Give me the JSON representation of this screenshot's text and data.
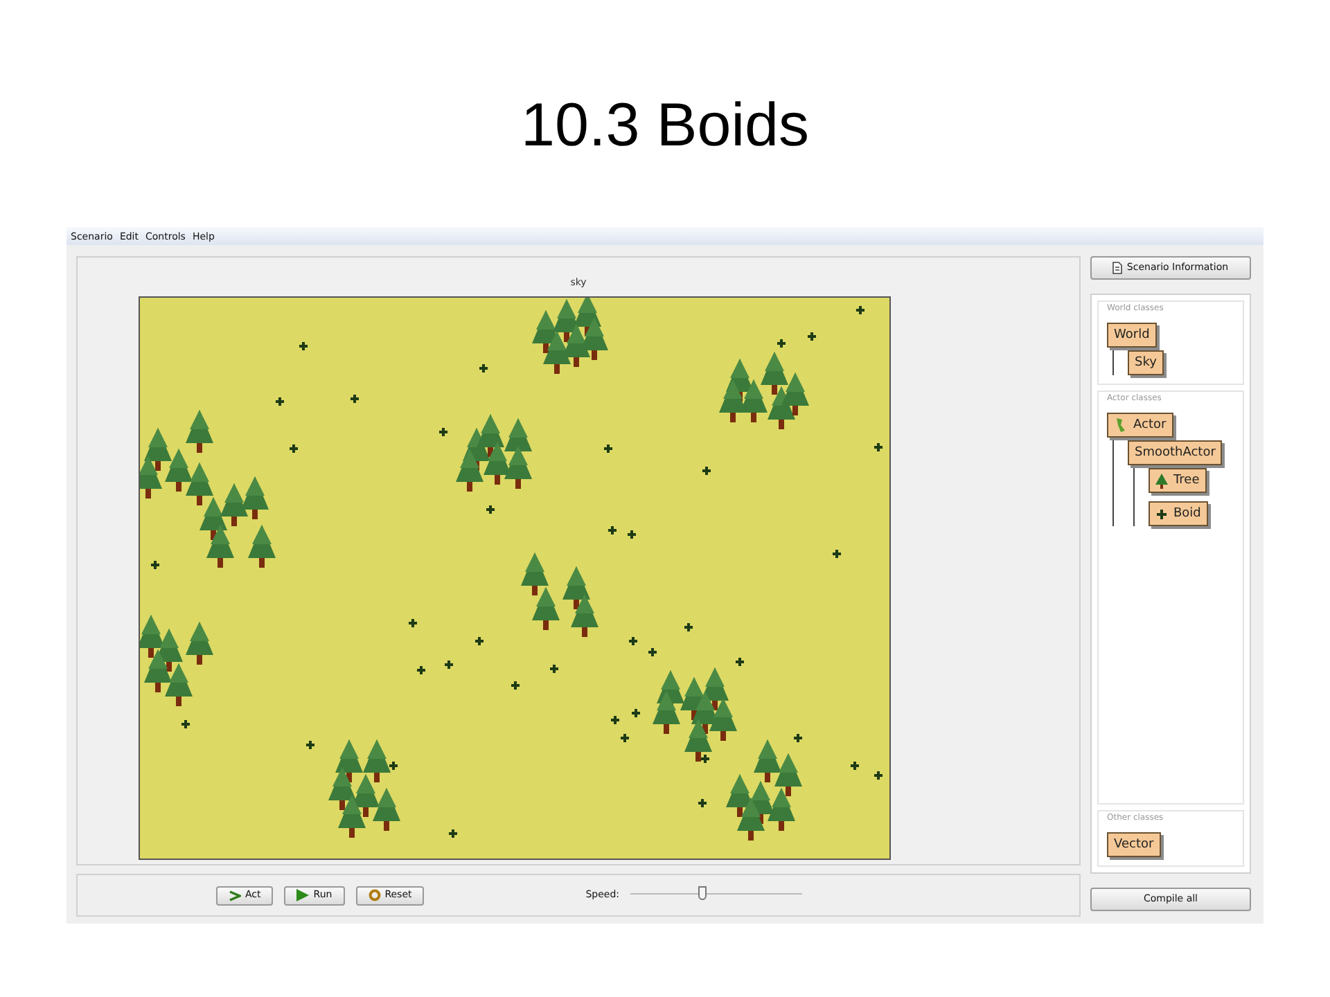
{
  "slide": {
    "title": "10.3 Boids"
  },
  "menu": [
    "Scenario",
    "Edit",
    "Controls",
    "Help"
  ],
  "world": {
    "title": "sky"
  },
  "controls": {
    "buttons": [
      {
        "label": "Act",
        "kind": "step"
      },
      {
        "label": "Run",
        "kind": "play"
      },
      {
        "label": "Reset",
        "kind": "reset"
      }
    ],
    "speed": {
      "label": "Speed:",
      "level": 0.42
    }
  },
  "sidebar": {
    "info_button": "Scenario Information",
    "sections": [
      {
        "label": "World classes",
        "classes": [
          {
            "name": "World",
            "children": [
              {
                "name": "Sky"
              }
            ]
          }
        ]
      },
      {
        "label": "Actor classes",
        "classes": [
          {
            "name": "Actor",
            "kind": "actor",
            "children": [
              {
                "name": "SmoothActor",
                "children": [
                  {
                    "name": "Tree",
                    "kind": "tree"
                  },
                  {
                    "name": "Boid",
                    "kind": "boid"
                  }
                ]
              }
            ]
          }
        ]
      },
      {
        "label": "Other classes",
        "classes": [
          {
            "name": "Vector"
          }
        ]
      }
    ],
    "compile_button": "Compile all"
  }
}
